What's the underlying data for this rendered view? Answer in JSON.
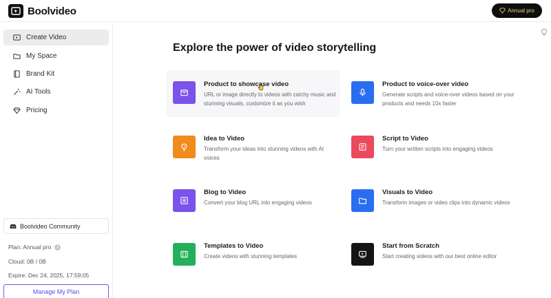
{
  "app": {
    "name": "Boolvideo"
  },
  "header": {
    "annual_pro_label": "Annual pro"
  },
  "sidebar": {
    "items": [
      {
        "label": "Create Video",
        "icon": "video-icon",
        "active": true
      },
      {
        "label": "My Space",
        "icon": "folder-icon"
      },
      {
        "label": "Brand Kit",
        "icon": "book-icon"
      },
      {
        "label": "AI Tools",
        "icon": "magic-wand-icon"
      },
      {
        "label": "Pricing",
        "icon": "diamond-icon"
      }
    ],
    "community_label": "Boolvideo Community",
    "plan": "Plan: Annual pro",
    "cloud": "Cloud: 0B / 0B",
    "expire": "Expire: Dec 24, 2025, 17:59:05",
    "manage_label": "Manage My Plan"
  },
  "main": {
    "title": "Explore the power of video storytelling",
    "cards": [
      {
        "title": "Product to showcase video",
        "desc": "URL or image directly to videos with catchy music and stunning visuals, customize it as you wish",
        "color": "#7b52ea",
        "icon": "box-icon"
      },
      {
        "title": "Product to voice-over video",
        "desc": "Generate scripts and voice-over videos based on your products and needs 10x faster",
        "color": "#2a6ef0",
        "icon": "microphone-icon"
      },
      {
        "title": "Idea to Video",
        "desc": "Transform your ideas into stunning videos with AI voices",
        "color": "#f28a1e",
        "icon": "lightbulb-icon"
      },
      {
        "title": "Script to Video",
        "desc": "Turn your written scripts into engaging videos",
        "color": "#ea4a5c",
        "icon": "script-icon"
      },
      {
        "title": "Blog to Video",
        "desc": "Convert your blog URL into engaging videos",
        "color": "#7b52ea",
        "icon": "document-icon"
      },
      {
        "title": "Visuals to Video",
        "desc": "Transform images or video clips into dynamic videos",
        "color": "#2a6ef0",
        "icon": "folder-icon"
      },
      {
        "title": "Templates to Video",
        "desc": "Create videos with stunning templates",
        "color": "#24b05a",
        "icon": "template-icon"
      },
      {
        "title": "Start from Scratch",
        "desc": "Start creating videos with our best online editor",
        "color": "#141414",
        "icon": "editor-icon"
      }
    ]
  },
  "colors": {
    "accent": "#5b4be6",
    "gold": "#f3d27a"
  }
}
